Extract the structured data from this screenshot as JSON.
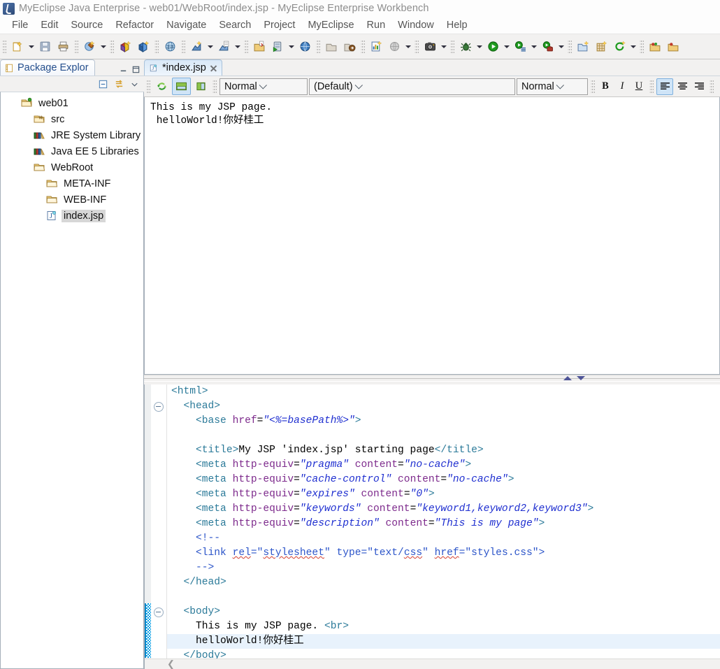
{
  "window": {
    "title": "MyEclipse Java Enterprise - web01/WebRoot/index.jsp - MyEclipse Enterprise Workbench",
    "app_icon": "myeclipse-logo-icon"
  },
  "menubar": {
    "items": [
      {
        "label": "File"
      },
      {
        "label": "Edit"
      },
      {
        "label": "Source"
      },
      {
        "label": "Refactor"
      },
      {
        "label": "Navigate"
      },
      {
        "label": "Search"
      },
      {
        "label": "Project"
      },
      {
        "label": "MyEclipse"
      },
      {
        "label": "Run"
      },
      {
        "label": "Window"
      },
      {
        "label": "Help"
      }
    ]
  },
  "toolbar": {
    "groups": [
      {
        "buttons": [
          {
            "icon": "new-wizard-icon",
            "dropdown": true
          },
          {
            "icon": "save-icon",
            "dropdown": false
          },
          {
            "icon": "print-icon",
            "dropdown": false
          }
        ]
      },
      {
        "buttons": [
          {
            "icon": "deploy-myeclipse-icon",
            "dropdown": true
          }
        ]
      },
      {
        "buttons": [
          {
            "icon": "new-package-red-icon",
            "dropdown": false
          },
          {
            "icon": "new-package-blue-icon",
            "dropdown": false
          }
        ]
      },
      {
        "buttons": [
          {
            "icon": "web20-browser-icon",
            "dropdown": false
          }
        ]
      },
      {
        "buttons": [
          {
            "icon": "new-java-class-icon",
            "dropdown": true
          },
          {
            "icon": "new-java-file-icon",
            "dropdown": true
          }
        ]
      },
      {
        "buttons": [
          {
            "icon": "open-type-icon",
            "dropdown": false
          },
          {
            "icon": "run-server-icon",
            "dropdown": true
          },
          {
            "icon": "globe-web-icon",
            "dropdown": false
          }
        ]
      },
      {
        "buttons": [
          {
            "icon": "open-external-icon",
            "dropdown": false
          },
          {
            "icon": "export-icon",
            "dropdown": false
          }
        ]
      },
      {
        "buttons": [
          {
            "icon": "report-icon",
            "dropdown": false
          },
          {
            "icon": "web-preview-icon",
            "dropdown": true
          }
        ]
      },
      {
        "buttons": [
          {
            "icon": "snapshot-camera-icon",
            "dropdown": true
          }
        ]
      },
      {
        "buttons": [
          {
            "icon": "debug-bug-icon",
            "dropdown": true
          },
          {
            "icon": "run-play-icon",
            "dropdown": true
          },
          {
            "icon": "run-history-icon",
            "dropdown": true
          },
          {
            "icon": "run-external-tools-icon",
            "dropdown": true
          }
        ]
      },
      {
        "buttons": [
          {
            "icon": "new-folder-icon",
            "dropdown": false
          },
          {
            "icon": "new-table-icon",
            "dropdown": false
          },
          {
            "icon": "refresh-green-icon",
            "dropdown": true
          }
        ]
      },
      {
        "buttons": [
          {
            "icon": "open-project-icon",
            "dropdown": false
          },
          {
            "icon": "open-resource-icon",
            "dropdown": false
          }
        ]
      }
    ]
  },
  "package_explorer": {
    "tab_label": "Package Explor",
    "tab_icon": "package-explorer-icon",
    "view_controls": [
      {
        "icon": "minimize-icon"
      },
      {
        "icon": "maximize-icon"
      }
    ],
    "toolbar_icons": [
      {
        "icon": "collapse-all-icon"
      },
      {
        "icon": "link-with-editor-icon"
      },
      {
        "icon": "view-menu-icon"
      }
    ],
    "tree": [
      {
        "label": "web01",
        "icon": "java-project-icon",
        "indent": 0,
        "selected": false
      },
      {
        "label": "src",
        "icon": "source-folder-icon",
        "indent": 1,
        "selected": false
      },
      {
        "label": "JRE System Library",
        "icon": "library-icon",
        "indent": 1,
        "selected": false
      },
      {
        "label": "Java EE 5 Libraries",
        "icon": "library-icon",
        "indent": 1,
        "selected": false
      },
      {
        "label": "WebRoot",
        "icon": "folder-icon",
        "indent": 1,
        "selected": false
      },
      {
        "label": "META-INF",
        "icon": "folder-icon",
        "indent": 2,
        "selected": false
      },
      {
        "label": "WEB-INF",
        "icon": "folder-icon",
        "indent": 2,
        "selected": false
      },
      {
        "label": "index.jsp",
        "icon": "jsp-file-icon",
        "indent": 2,
        "selected": true
      }
    ]
  },
  "editor": {
    "tab_label": "*index.jsp",
    "tab_icon": "jsp-file-icon",
    "close_icon": "close-icon",
    "toolbar": {
      "refresh_icon": "refresh-preview-icon",
      "layout_horizontal_icon": "split-horizontal-icon",
      "layout_vertical_icon": "split-vertical-icon",
      "style_combo_value": "Normal",
      "font_combo_value": "(Default)",
      "size_combo_value": "Normal",
      "bold_label": "B",
      "italic_label": "I",
      "underline_label": "U",
      "align_left_icon": "align-left-icon",
      "align_center_icon": "align-center-icon",
      "align_right_icon": "align-right-icon",
      "fill-color_icon": "fill-color-icon"
    },
    "design_preview": {
      "line1": "This is my JSP page.",
      "line2": " helloWorld!你好桂工"
    },
    "sash": {
      "up_arrow_icon": "sash-up-arrow-icon",
      "down_arrow_icon": "sash-down-arrow-icon"
    },
    "source": {
      "lines": [
        {
          "indent": 1,
          "segments": [
            {
              "t": "tag",
              "s": "<html>"
            }
          ]
        },
        {
          "indent": 2,
          "fold": true,
          "segments": [
            {
              "t": "tag",
              "s": "<head>"
            }
          ]
        },
        {
          "indent": 3,
          "segments": [
            {
              "t": "tag",
              "s": "<base "
            },
            {
              "t": "attr",
              "s": "href"
            },
            {
              "t": "txt",
              "s": "="
            },
            {
              "t": "val",
              "s": "\"<%=basePath%>\""
            },
            {
              "t": "tag",
              "s": ">"
            }
          ]
        },
        {
          "indent": 3,
          "segments": []
        },
        {
          "indent": 3,
          "segments": [
            {
              "t": "tag",
              "s": "<title>"
            },
            {
              "t": "txt",
              "s": "My JSP 'index.jsp' starting page"
            },
            {
              "t": "tag",
              "s": "</title>"
            }
          ]
        },
        {
          "indent": 3,
          "segments": [
            {
              "t": "tag",
              "s": "<meta "
            },
            {
              "t": "attr",
              "s": "http-equiv"
            },
            {
              "t": "txt",
              "s": "="
            },
            {
              "t": "val",
              "s": "\"pragma\""
            },
            {
              "t": "attr",
              "s": " content"
            },
            {
              "t": "txt",
              "s": "="
            },
            {
              "t": "val",
              "s": "\"no-cache\""
            },
            {
              "t": "tag",
              "s": ">"
            }
          ]
        },
        {
          "indent": 3,
          "segments": [
            {
              "t": "tag",
              "s": "<meta "
            },
            {
              "t": "attr",
              "s": "http-equiv"
            },
            {
              "t": "txt",
              "s": "="
            },
            {
              "t": "val",
              "s": "\"cache-control\""
            },
            {
              "t": "attr",
              "s": " content"
            },
            {
              "t": "txt",
              "s": "="
            },
            {
              "t": "val",
              "s": "\"no-cache\""
            },
            {
              "t": "tag",
              "s": ">"
            }
          ]
        },
        {
          "indent": 3,
          "segments": [
            {
              "t": "tag",
              "s": "<meta "
            },
            {
              "t": "attr",
              "s": "http-equiv"
            },
            {
              "t": "txt",
              "s": "="
            },
            {
              "t": "val",
              "s": "\"expires\""
            },
            {
              "t": "attr",
              "s": " content"
            },
            {
              "t": "txt",
              "s": "="
            },
            {
              "t": "val",
              "s": "\"0\""
            },
            {
              "t": "tag",
              "s": ">"
            }
          ]
        },
        {
          "indent": 3,
          "segments": [
            {
              "t": "tag",
              "s": "<meta "
            },
            {
              "t": "attr",
              "s": "http-equiv"
            },
            {
              "t": "txt",
              "s": "="
            },
            {
              "t": "val",
              "s": "\"keywords\""
            },
            {
              "t": "attr",
              "s": " content"
            },
            {
              "t": "txt",
              "s": "="
            },
            {
              "t": "val",
              "s": "\"keyword1,keyword2,keyword3\""
            },
            {
              "t": "tag",
              "s": ">"
            }
          ]
        },
        {
          "indent": 3,
          "segments": [
            {
              "t": "tag",
              "s": "<meta "
            },
            {
              "t": "attr",
              "s": "http-equiv"
            },
            {
              "t": "txt",
              "s": "="
            },
            {
              "t": "val",
              "s": "\"description\""
            },
            {
              "t": "attr",
              "s": " content"
            },
            {
              "t": "txt",
              "s": "="
            },
            {
              "t": "val",
              "s": "\"This is my page\""
            },
            {
              "t": "tag",
              "s": ">"
            }
          ]
        },
        {
          "indent": 3,
          "segments": [
            {
              "t": "cmt",
              "s": "<!--"
            }
          ]
        },
        {
          "indent": 3,
          "segments": [
            {
              "t": "cmt",
              "s": "<link "
            },
            {
              "t": "cmt sq",
              "s": "rel"
            },
            {
              "t": "cmt",
              "s": "=\""
            },
            {
              "t": "cmt sq",
              "s": "stylesheet"
            },
            {
              "t": "cmt",
              "s": "\" type=\"text/"
            },
            {
              "t": "cmt sq",
              "s": "css"
            },
            {
              "t": "cmt",
              "s": "\" "
            },
            {
              "t": "cmt sq",
              "s": "href"
            },
            {
              "t": "cmt",
              "s": "=\"styles.css\">"
            }
          ]
        },
        {
          "indent": 3,
          "segments": [
            {
              "t": "cmt",
              "s": "-->"
            }
          ]
        },
        {
          "indent": 2,
          "segments": [
            {
              "t": "tag",
              "s": "</head>"
            }
          ]
        },
        {
          "indent": 2,
          "segments": []
        },
        {
          "indent": 2,
          "fold": true,
          "segments": [
            {
              "t": "tag",
              "s": "<body>"
            }
          ]
        },
        {
          "indent": 3,
          "segments": [
            {
              "t": "txt",
              "s": "This is my JSP page. "
            },
            {
              "t": "tag",
              "s": "<br>"
            }
          ]
        },
        {
          "indent": 3,
          "current": true,
          "segments": [
            {
              "t": "txt",
              "s": "helloWorld!你好桂工"
            }
          ]
        },
        {
          "indent": 2,
          "segments": [
            {
              "t": "tag",
              "s": "</body>"
            }
          ]
        }
      ],
      "change_marker": "changed-lines-marker"
    },
    "horizontal_scrollbar": "editor-h-scrollbar"
  },
  "colors": {
    "tag": "#2b7a99",
    "attribute": "#7d2a8c",
    "value": "#1f2fd0",
    "comment": "#2c55c9",
    "selection": "#d7d7d7",
    "current_line": "#e8f2fc",
    "change_marker": "#0aa0e6",
    "tab_active": "#d9e8f7"
  }
}
